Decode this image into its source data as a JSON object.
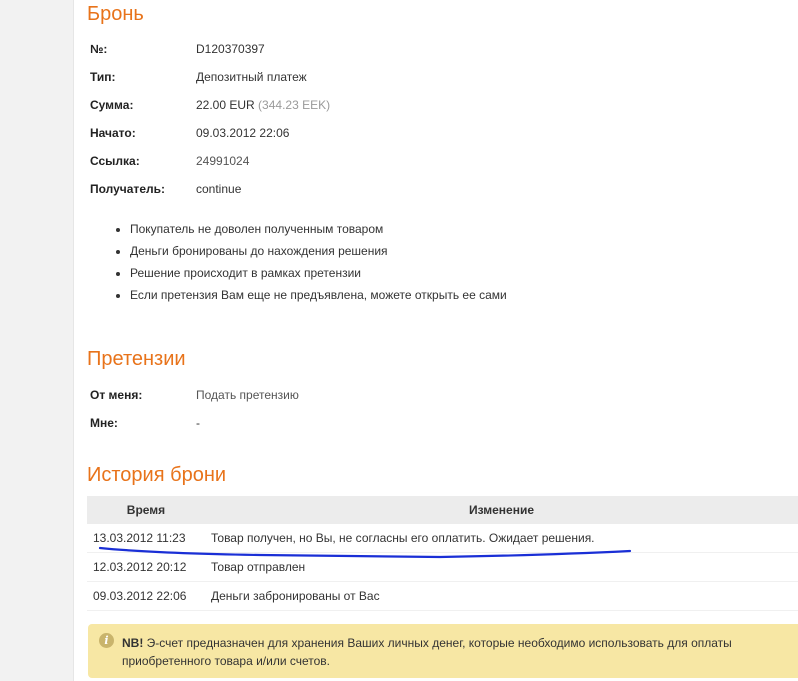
{
  "booking": {
    "title": "Бронь",
    "fields": [
      {
        "label": "№:",
        "value": "D120370397"
      },
      {
        "label": "Тип:",
        "value": "Депозитный платеж"
      },
      {
        "label": "Сумма:",
        "value": "22.00 EUR",
        "extra": "(344.23 EEK)"
      },
      {
        "label": "Начато:",
        "value": "09.03.2012 22:06"
      },
      {
        "label": "Ссылка:",
        "value": "24991024"
      },
      {
        "label": "Получатель:",
        "value": "continue"
      }
    ],
    "notes": [
      "Покупатель не доволен полученным товаром",
      "Деньги бронированы до нахождения решения",
      "Решение происходит в рамках претензии",
      "Если претензия Вам еще не предъявлена, можете открыть ее сами"
    ]
  },
  "claims": {
    "title": "Претензии",
    "fields": [
      {
        "label": "От меня:",
        "value": "Подать претензию"
      },
      {
        "label": "Мне:",
        "value": "-"
      }
    ]
  },
  "history": {
    "title": "История брони",
    "columns": [
      "Время",
      "Изменение"
    ],
    "rows": [
      {
        "time": "13.03.2012 11:23",
        "change": "Товар получен, но Вы, не согласны его оплатить. Ожидает решения."
      },
      {
        "time": "12.03.2012 20:12",
        "change": "Товар отправлен"
      },
      {
        "time": "09.03.2012 22:06",
        "change": "Деньги забронированы от Вас"
      }
    ]
  },
  "notice": {
    "icon": "info-icon",
    "icon_glyph": "i",
    "prefix": "NB!",
    "text": " Э-счет предназначен для хранения Ваших личных денег, которые необходимо использовать для оплаты приобретенного товара и/или счетов."
  },
  "colors": {
    "accent": "#e8731a",
    "scribble": "#1a2fd6",
    "notice_bg": "#f7e7a4"
  }
}
